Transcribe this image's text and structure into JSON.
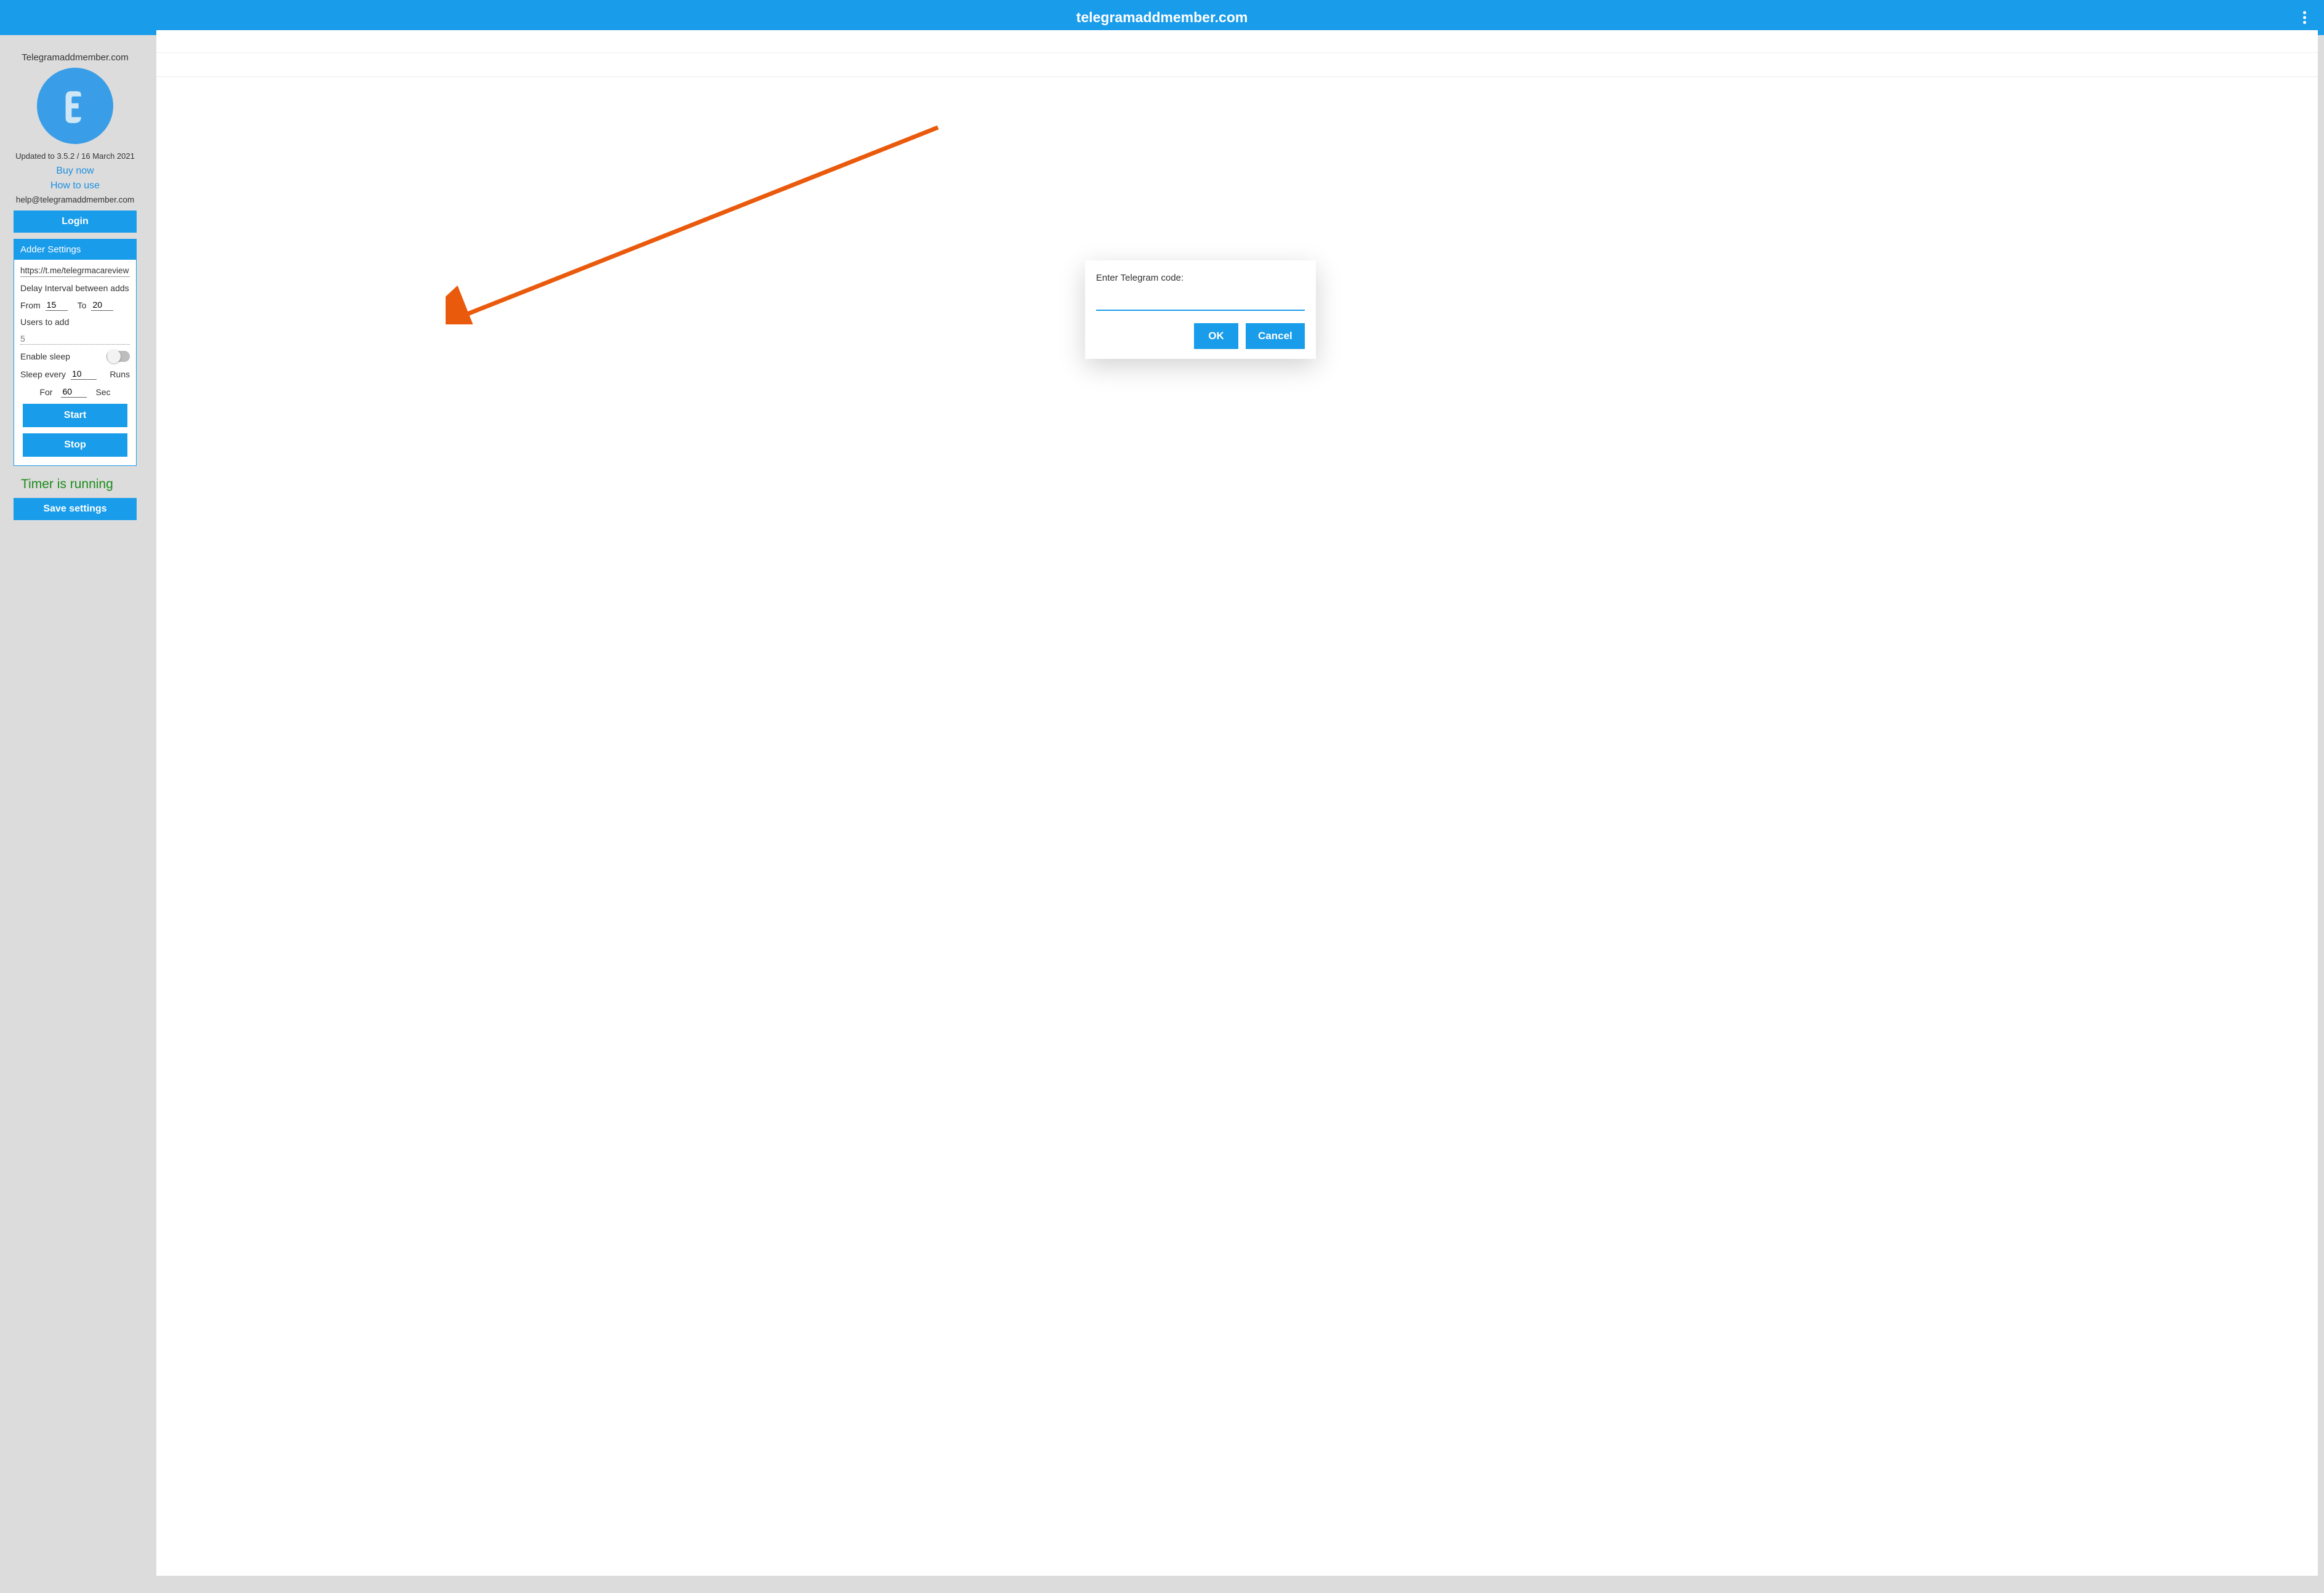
{
  "topbar": {
    "title": "telegramaddmember.com"
  },
  "sidebar": {
    "brand": "Telegramaddmember.com",
    "version": "Updated to 3.5.2 / 16 March 2021",
    "buy_now": "Buy now",
    "how_to_use": "How to use",
    "help_email": "help@telegramaddmember.com",
    "login_label": "Login",
    "panel_title": "Adder Settings",
    "url_value": "https://t.me/telegrmacareview",
    "delay_label": "Delay Interval between adds",
    "from_label": "From",
    "from_value": "15",
    "to_label": "To",
    "to_value": "20",
    "users_label": "Users to add",
    "users_value": "5",
    "enable_sleep_label": "Enable sleep",
    "sleep_every_label": "Sleep every",
    "sleep_every_value": "10",
    "runs_label": "Runs",
    "for_label": "For",
    "for_value": "60",
    "sec_label": "Sec",
    "start_label": "Start",
    "stop_label": "Stop",
    "timer_text": "Timer is running",
    "save_label": "Save settings"
  },
  "dialog": {
    "prompt": "Enter Telegram code:",
    "input_value": "",
    "ok_label": "OK",
    "cancel_label": "Cancel"
  }
}
